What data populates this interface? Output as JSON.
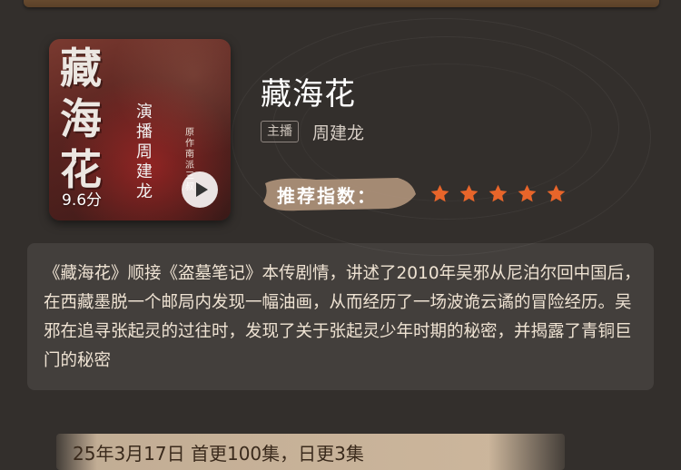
{
  "cover": {
    "title_art": "藏海花",
    "narrator_art": "演播 周建龙",
    "author_art": "原作 南派三叔",
    "rating": "9.6分"
  },
  "book": {
    "title": "藏海花",
    "host_label": "主播",
    "host_name": "周建龙"
  },
  "recommend": {
    "label": "推荐指数：",
    "stars": 5,
    "star_color": "#e8652a"
  },
  "description": "《藏海花》顺接《盗墓笔记》本传剧情，讲述了2010年吴邪从尼泊尔回中国后，在西藏墨脱一个邮局内发现一幅油画，从而经历了一场波诡云谲的冒险经历。吴邪在追寻张起灵的过往时，发现了关于张起灵少年时期的秘密，并揭露了青铜巨门的秘密",
  "update_info": "25年3月17日 首更100集，日更3集",
  "colors": {
    "background": "#332f2c",
    "accent": "#e8652a",
    "banner": "#e6cdaf"
  }
}
